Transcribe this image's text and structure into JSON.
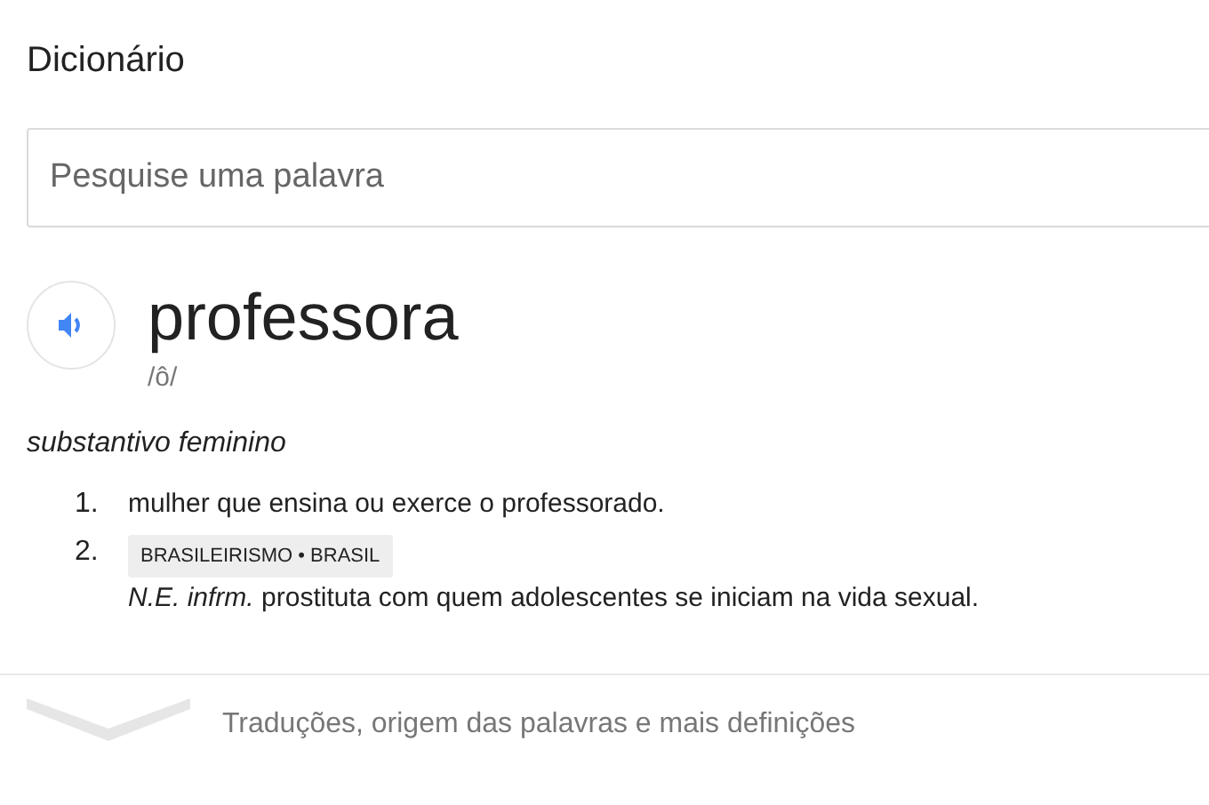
{
  "title": "Dicionário",
  "search": {
    "placeholder": "Pesquise uma palavra"
  },
  "entry": {
    "word": "professora",
    "pronunciation": "/ô/",
    "part_of_speech": "substantivo feminino",
    "senses": [
      {
        "number": "1.",
        "definition": "mulher que ensina ou exerce o professorado."
      },
      {
        "number": "2.",
        "tag": "BRASILEIRISMO • BRASIL",
        "definition": "*N.E. infrm.* prostituta com quem adolescentes se iniciam na vida sexual."
      }
    ]
  },
  "more_link": "Traduções, origem das palavras e mais definições"
}
